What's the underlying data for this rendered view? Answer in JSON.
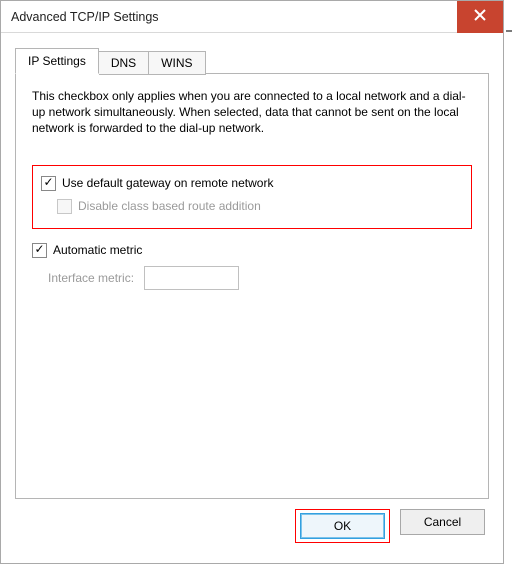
{
  "window": {
    "title": "Advanced TCP/IP Settings"
  },
  "tabs": {
    "items": [
      {
        "label": "IP Settings"
      },
      {
        "label": "DNS"
      },
      {
        "label": "WINS"
      }
    ]
  },
  "panel": {
    "description": "This checkbox only applies when you are connected to a local network and a dial-up network simultaneously. When selected, data that cannot be sent on the local network is forwarded to the dial-up network.",
    "use_default_gateway_label": "Use default gateway on remote network",
    "use_default_gateway_checked": true,
    "disable_class_route_label": "Disable class based route addition",
    "disable_class_route_enabled": false,
    "automatic_metric_label": "Automatic metric",
    "automatic_metric_checked": true,
    "interface_metric_label": "Interface metric:",
    "interface_metric_value": ""
  },
  "buttons": {
    "ok": "OK",
    "cancel": "Cancel"
  }
}
